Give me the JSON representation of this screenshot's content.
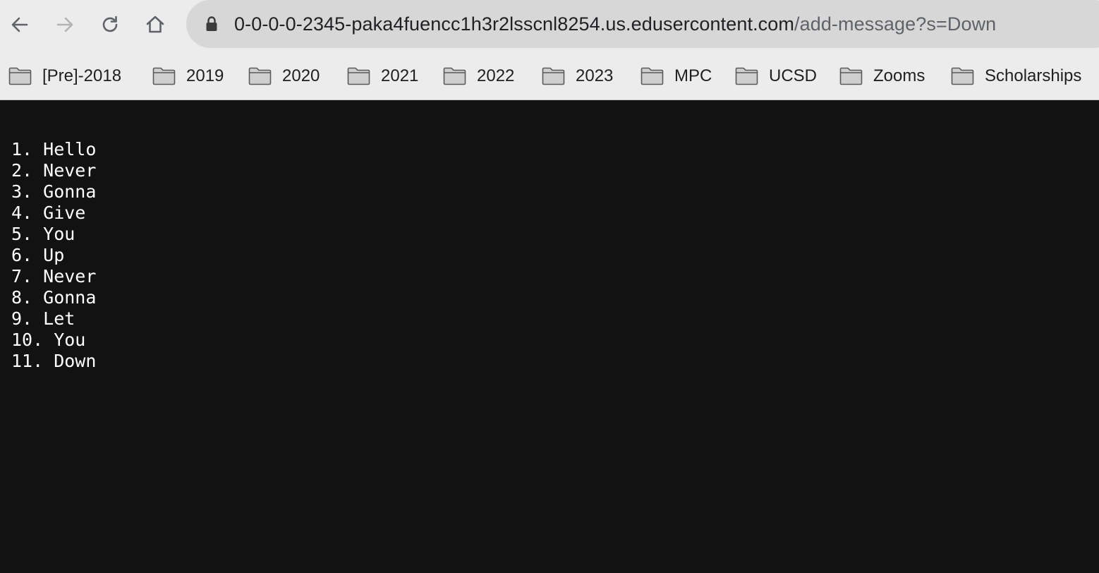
{
  "browser": {
    "url_host": "0-0-0-0-2345-paka4fuencc1h3r2lsscnl8254.us.edusercontent.com",
    "url_path": "/add-message?s=Down",
    "nav_icons": [
      "back-icon",
      "forward-icon",
      "reload-icon",
      "home-icon",
      "lock-icon"
    ]
  },
  "bookmarks": [
    {
      "label": "[Pre]-2018"
    },
    {
      "label": "2019"
    },
    {
      "label": "2020"
    },
    {
      "label": "2021"
    },
    {
      "label": "2022"
    },
    {
      "label": "2023"
    },
    {
      "label": "MPC"
    },
    {
      "label": "UCSD"
    },
    {
      "label": "Zooms"
    },
    {
      "label": "Scholarships"
    }
  ],
  "messages": [
    "1. Hello",
    "2. Never",
    "3. Gonna",
    "4. Give",
    "5. You",
    "6. Up",
    "7. Never",
    "8. Gonna",
    "9. Let",
    "10. You",
    "11. Down"
  ],
  "colors": {
    "chrome_bg": "#ececec",
    "address_bar_bg": "#d7d7d7",
    "page_bg": "#121212",
    "page_text": "#ffffff"
  }
}
